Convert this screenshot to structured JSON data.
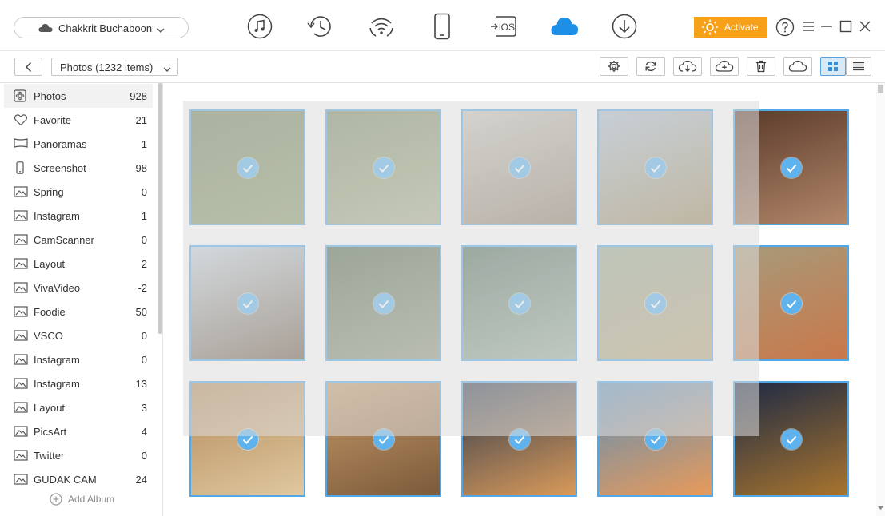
{
  "device": {
    "name": "Chakkrit Buchaboon",
    "icon": "cloud-icon"
  },
  "nav_icons": [
    "music-icon",
    "history-icon",
    "wifi-sync-icon",
    "phone-icon",
    "ios-icon",
    "icloud-icon",
    "download-icon"
  ],
  "nav_ios_label": "iOS",
  "activate_label": "Activate",
  "toolbar": {
    "category": "Photos (1232 items)",
    "buttons": [
      "settings-icon",
      "refresh-icon",
      "download-to-pc-icon",
      "upload-icon",
      "delete-icon",
      "cloud-icon",
      "grid-view-icon",
      "list-view-icon"
    ]
  },
  "sidebar": {
    "items": [
      {
        "label": "Photos",
        "count": "928",
        "icon": "photos-icon"
      },
      {
        "label": "Favorite",
        "count": "21",
        "icon": "heart-icon"
      },
      {
        "label": "Panoramas",
        "count": "1",
        "icon": "panorama-icon"
      },
      {
        "label": "Screenshot",
        "count": "98",
        "icon": "phone-icon"
      },
      {
        "label": "Spring",
        "count": "0",
        "icon": "album-icon"
      },
      {
        "label": "Instagram",
        "count": "1",
        "icon": "album-icon"
      },
      {
        "label": "CamScanner",
        "count": "0",
        "icon": "album-icon"
      },
      {
        "label": "Layout",
        "count": "2",
        "icon": "album-icon"
      },
      {
        "label": "VivaVideo",
        "count": "-2",
        "icon": "album-icon"
      },
      {
        "label": "Foodie",
        "count": "50",
        "icon": "album-icon"
      },
      {
        "label": "VSCO",
        "count": "0",
        "icon": "album-icon"
      },
      {
        "label": "Instagram",
        "count": "0",
        "icon": "album-icon"
      },
      {
        "label": "Instagram",
        "count": "13",
        "icon": "album-icon"
      },
      {
        "label": "Layout",
        "count": "3",
        "icon": "album-icon"
      },
      {
        "label": "PicsArt",
        "count": "4",
        "icon": "album-icon"
      },
      {
        "label": "Twitter",
        "count": "0",
        "icon": "album-icon"
      },
      {
        "label": "GUDAK CAM",
        "count": "24",
        "icon": "album-icon"
      }
    ],
    "add_album": "Add Album"
  },
  "photos": {
    "checked": true,
    "colors": [
      [
        "#6f7f58",
        "#8a9a6a"
      ],
      [
        "#78895f",
        "#a9b08a"
      ],
      [
        "#c9c6bd",
        "#8d7e6a"
      ],
      [
        "#aebfd0",
        "#9c8a5e"
      ],
      [
        "#5a3a2a",
        "#b2876a"
      ],
      [
        "#c6d3dc",
        "#6b5844"
      ],
      [
        "#4f6447",
        "#8f9880"
      ],
      [
        "#4f6c5a",
        "#9bb0a0"
      ],
      [
        "#9aa890",
        "#b7a77a"
      ],
      [
        "#a79a7a",
        "#c9784a"
      ],
      [
        "#b38a5a",
        "#e0c8a0"
      ],
      [
        "#c59a6a",
        "#7c5a3a"
      ],
      [
        "#2e3a4c",
        "#d99a5a"
      ],
      [
        "#5c8fb8",
        "#e89a5a"
      ],
      [
        "#1d2a44",
        "#a8742e"
      ]
    ]
  }
}
